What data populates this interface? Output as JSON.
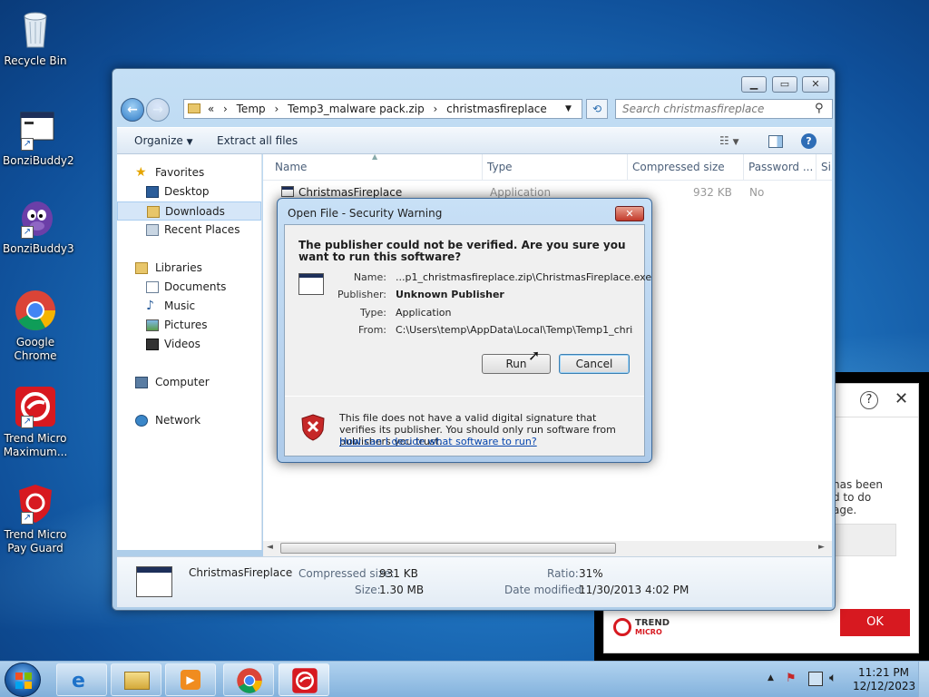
{
  "desktop": {
    "icons": [
      {
        "label": "Recycle Bin"
      },
      {
        "label": "BonziBuddy2"
      },
      {
        "label": "BonziBuddy3"
      },
      {
        "label": "Google Chrome"
      },
      {
        "label": "Trend Micro Maximum..."
      },
      {
        "label": "Trend Micro Pay Guard"
      }
    ]
  },
  "explorer": {
    "address": {
      "chevron": "«",
      "crumbs": [
        "Temp",
        "Temp3_malware pack.zip",
        "christmasfireplace"
      ]
    },
    "search_placeholder": "Search christmasfireplace",
    "toolbar": {
      "organize": "Organize",
      "extract": "Extract all files"
    },
    "nav": {
      "favorites": "Favorites",
      "favorite_items": [
        "Desktop",
        "Downloads",
        "Recent Places"
      ],
      "libraries": "Libraries",
      "library_items": [
        "Documents",
        "Music",
        "Pictures",
        "Videos"
      ],
      "computer": "Computer",
      "network": "Network"
    },
    "columns": [
      "Name",
      "Type",
      "Compressed size",
      "Password ...",
      "Si"
    ],
    "file": {
      "name": "ChristmasFireplace",
      "type": "Application",
      "size": "932 KB",
      "password": "No"
    },
    "details": {
      "name": "ChristmasFireplace",
      "compressed_label": "Compressed size:",
      "compressed_value": "931 KB",
      "size_label": "Size:",
      "size_value": "1.30 MB",
      "ratio_label": "Ratio:",
      "ratio_value": "31%",
      "date_label": "Date modified:",
      "date_value": "11/30/2013 4:02 PM"
    }
  },
  "dialog": {
    "title": "Open File - Security Warning",
    "question": "The publisher could not be verified.  Are you sure you want to run this software?",
    "name_label": "Name:",
    "name_value": "...p1_christmasfireplace.zip\\ChristmasFireplace.exe",
    "publisher_label": "Publisher:",
    "publisher_value": "Unknown Publisher",
    "type_label": "Type:",
    "type_value": "Application",
    "from_label": "From:",
    "from_value": "C:\\Users\\temp\\AppData\\Local\\Temp\\Temp1_chris...",
    "run": "Run",
    "cancel": "Cancel",
    "warning": "This file does not have a valid digital signature that verifies its publisher.  You should only run software from publishers you trust.",
    "link": "How can I decide what software to run?"
  },
  "trend": {
    "help": "?",
    "close": "✕",
    "partial_lines": [
      "has been",
      "d to do",
      "age."
    ],
    "brand_line1": "TREND",
    "brand_line2": "MICRO",
    "ok": "OK",
    "brand_color": "#d71920"
  },
  "taskbar": {
    "time": "11:21 PM",
    "date": "12/12/2023"
  }
}
